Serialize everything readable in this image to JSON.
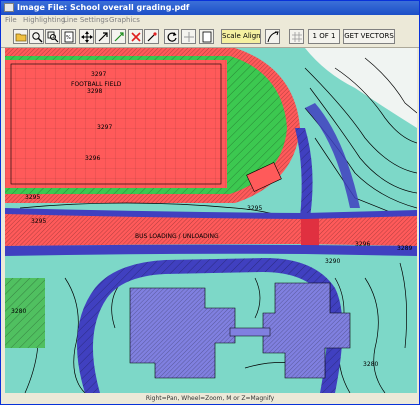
{
  "window": {
    "title": "Image File: School overall grading.pdf",
    "accent": "#1c4fc7"
  },
  "menu": [
    "File",
    "Highlighting",
    "Line Settings",
    "Graphics"
  ],
  "toolbar": {
    "tool_icons": [
      "folder-icon",
      "zoom-in-icon",
      "zoom-window-icon",
      "fit-page-icon",
      "pan-icon",
      "select-arrow-icon",
      "line-tool-icon",
      "delete-x-icon",
      "calibrate-icon",
      "rotate-icon",
      "crosshair-icon",
      "page-icon"
    ],
    "scale_align_label": "Scale Align",
    "page_indicator": "1 OF 1",
    "get_vectors_label": "GET VECTORS"
  },
  "map_labels": {
    "football_field": "FOOTBALL FIELD",
    "bus_loading": "BUS LOADING / UNLOADING",
    "contours": [
      "3297",
      "3298",
      "3297",
      "3296",
      "3295",
      "3295",
      "3295",
      "3296",
      "3290",
      "3289",
      "3280",
      "3280"
    ]
  },
  "colors": {
    "terrain_cyan": "#7dd8c8",
    "field_red": "#ff5a5a",
    "track_green": "#3cc850",
    "building_blue": "#8080e0",
    "paving_blue": "#4040c0",
    "lawn_green": "#50c060"
  },
  "status": "Right=Pan, Wheel=Zoom, M or  Z=Magnify"
}
